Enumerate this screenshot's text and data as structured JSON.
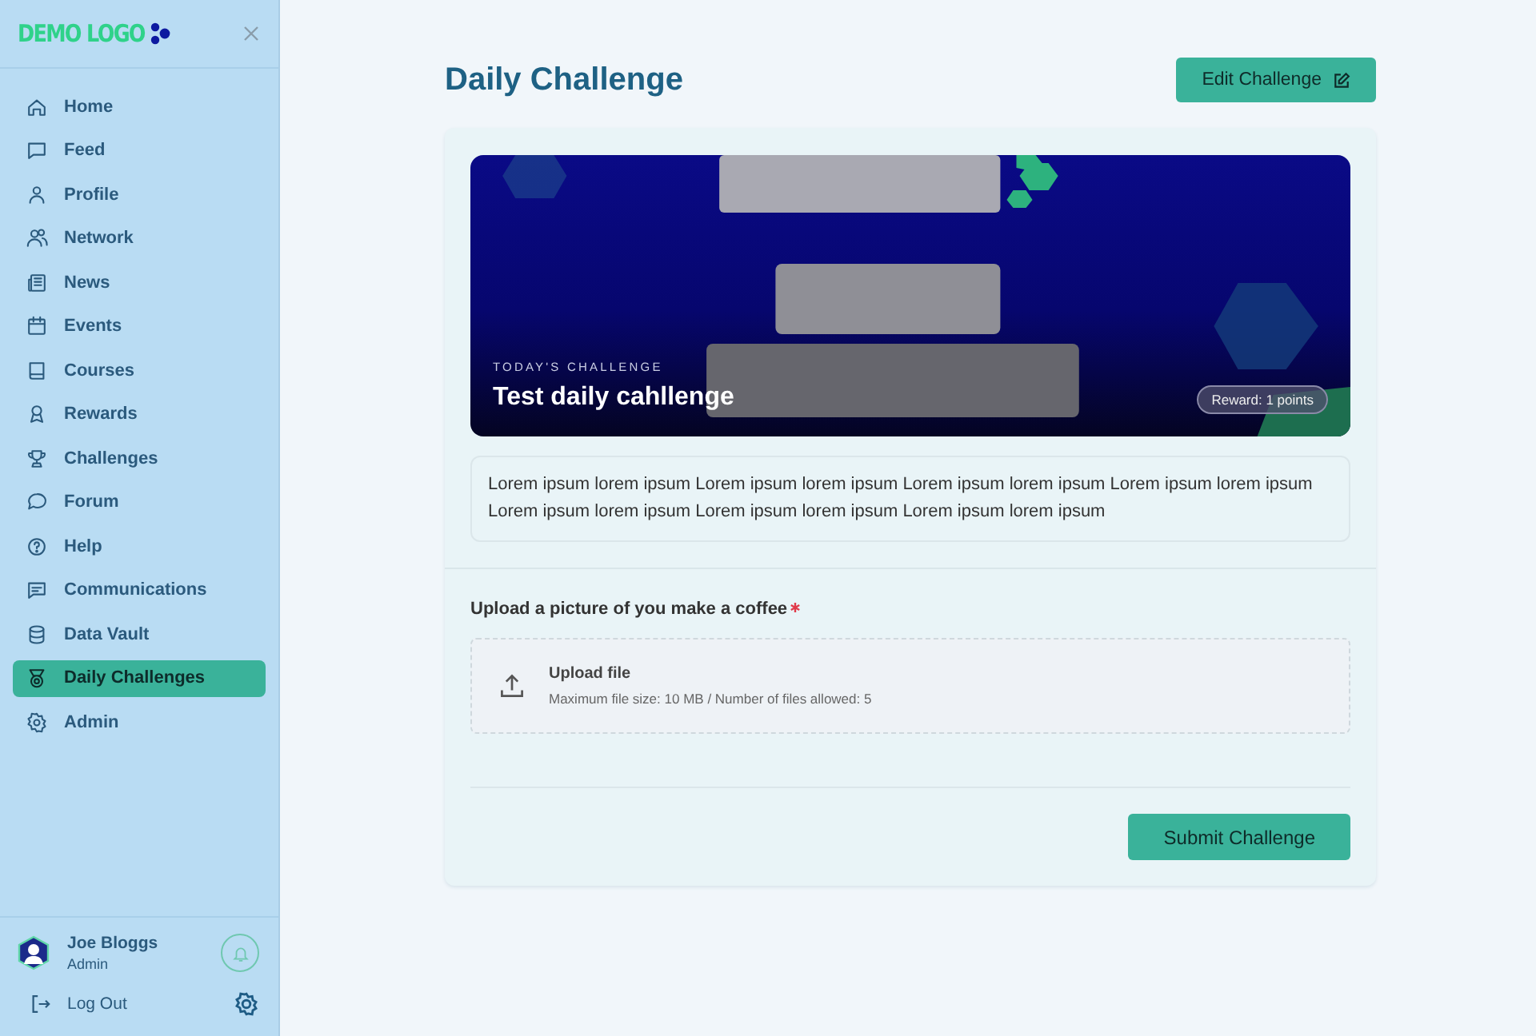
{
  "sidebar": {
    "logo": "DEMO LOGO",
    "items": [
      {
        "label": "Home",
        "selected": false
      },
      {
        "label": "Feed",
        "selected": false
      },
      {
        "label": "Profile",
        "selected": false
      },
      {
        "label": "Network",
        "selected": false
      },
      {
        "label": "News",
        "selected": false
      },
      {
        "label": "Events",
        "selected": false
      },
      {
        "label": "Courses",
        "selected": false
      },
      {
        "label": "Rewards",
        "selected": false
      },
      {
        "label": "Challenges",
        "selected": false
      },
      {
        "label": "Forum",
        "selected": false
      },
      {
        "label": "Help",
        "selected": false
      },
      {
        "label": "Communications",
        "selected": false
      },
      {
        "label": "Data Vault",
        "selected": false
      },
      {
        "label": "Daily Challenges",
        "selected": true
      },
      {
        "label": "Admin",
        "selected": false
      }
    ],
    "user": {
      "name": "Joe Bloggs",
      "role": "Admin"
    },
    "logout": "Log Out"
  },
  "page": {
    "title": "Daily Challenge",
    "edit_button": "Edit Challenge"
  },
  "challenge": {
    "eyebrow": "TODAY'S CHALLENGE",
    "title": "Test daily cahllenge",
    "reward": "Reward: 1 points",
    "description": "Lorem ipsum lorem ipsum Lorem ipsum lorem ipsum Lorem ipsum lorem ipsum Lorem ipsum lorem ipsum Lorem ipsum lorem ipsum Lorem ipsum lorem ipsum Lorem ipsum lorem ipsum",
    "upload": {
      "label": "Upload a picture of you make a coffee",
      "required": true,
      "title": "Upload file",
      "hint": "Maximum file size: 10 MB / Number of files allowed: 5"
    },
    "submit_button": "Submit Challenge"
  }
}
